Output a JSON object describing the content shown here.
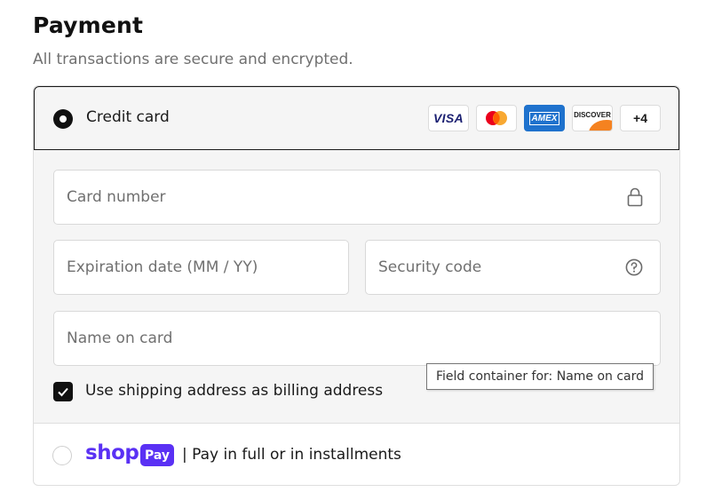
{
  "payment": {
    "title": "Payment",
    "subtitle": "All transactions are secure and encrypted."
  },
  "credit_card": {
    "label": "Credit card",
    "selected": true,
    "logos": {
      "visa": "VISA",
      "amex": "AMEX",
      "discover": "DISCOVER",
      "more": "+4"
    },
    "icons": [
      "visa-icon",
      "mastercard-icon",
      "amex-icon",
      "discover-icon",
      "lock-icon",
      "help-icon",
      "check-icon"
    ]
  },
  "fields": {
    "card_number": {
      "placeholder": "Card number",
      "value": ""
    },
    "expiration": {
      "placeholder": "Expiration date (MM / YY)",
      "value": ""
    },
    "security_code": {
      "placeholder": "Security code",
      "value": ""
    },
    "name_on_card": {
      "placeholder": "Name on card",
      "value": ""
    }
  },
  "billing": {
    "checked": true,
    "label": "Use shipping address as billing address"
  },
  "tooltip": {
    "text": "Field container for: Name on card"
  },
  "shop_pay": {
    "brand": "shop",
    "badge": "Pay",
    "text": "| Pay in full or in installments",
    "selected": false
  },
  "colors": {
    "accent": "#111111",
    "shop_purple": "#5a31f4",
    "panel_bg": "#f5f5f5",
    "muted_text": "#707070",
    "amex_blue": "#1f72cd",
    "discover_orange": "#f58220",
    "mc_red": "#eb001b",
    "mc_yellow": "#f79e1b"
  }
}
